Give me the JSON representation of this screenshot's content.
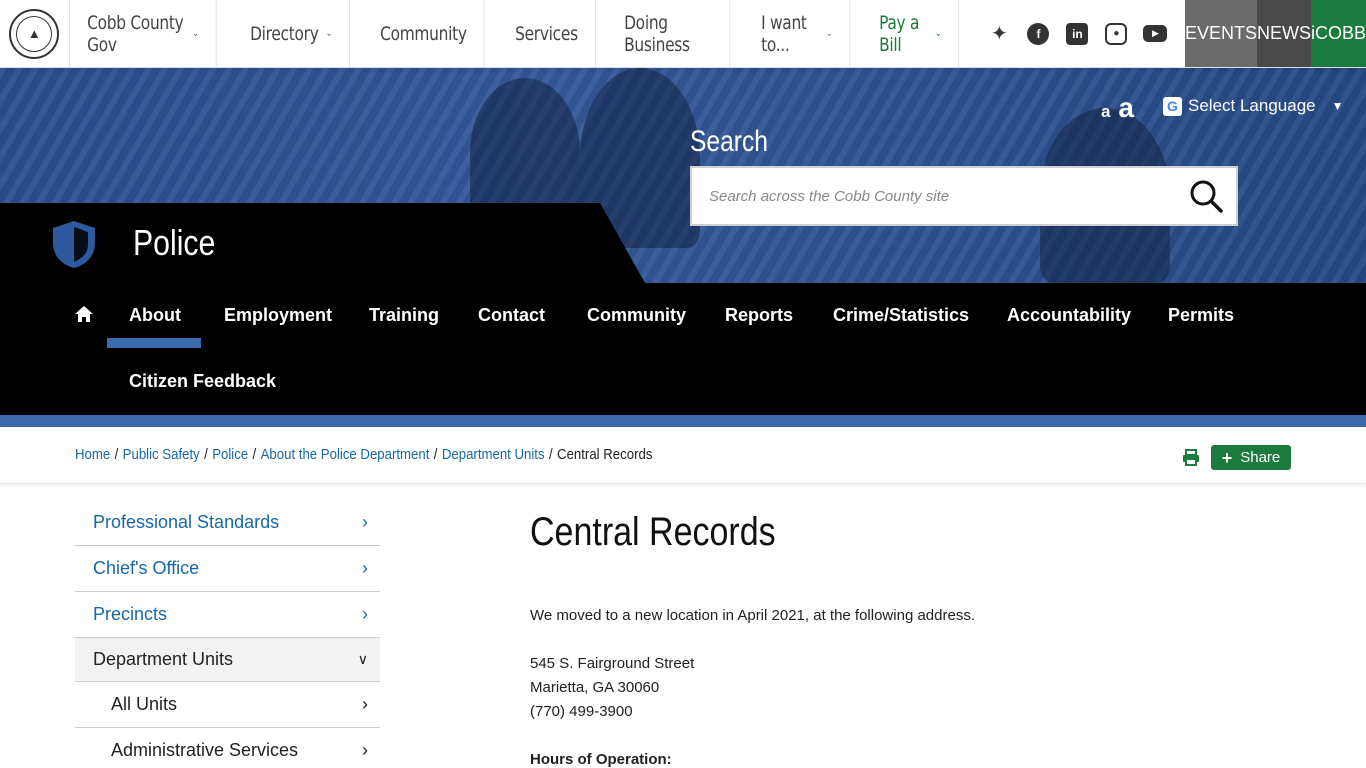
{
  "topnav": {
    "logo_alt": "Cobb County Georgia seal",
    "items": [
      {
        "label": "Cobb County Gov",
        "dropdown": true
      },
      {
        "label": "Directory",
        "dropdown": true
      },
      {
        "label": "Community",
        "dropdown": false
      },
      {
        "label": "Services",
        "dropdown": false
      },
      {
        "label": "Doing Business",
        "dropdown": false
      },
      {
        "label": "I want to...",
        "dropdown": true
      },
      {
        "label": "Pay a Bill",
        "dropdown": true
      }
    ],
    "social": [
      "twitter-icon",
      "facebook-icon",
      "linkedin-icon",
      "instagram-icon",
      "youtube-icon"
    ],
    "tiles": {
      "events": "EVENTS",
      "news": "NEWS",
      "icobb": "iCOBB"
    }
  },
  "colors": {
    "accent_blue": "#3b6aad",
    "link_blue": "#1668a6",
    "brand_green": "#1b7a3e"
  },
  "hero": {
    "text_small": "a",
    "text_large": "a",
    "language": "Select Language",
    "search_label": "Search",
    "search_placeholder": "Search across the Cobb County site"
  },
  "department": {
    "title": "Police"
  },
  "subnav": {
    "items": [
      "About",
      "Employment",
      "Training",
      "Contact",
      "Community",
      "Reports",
      "Crime/Statistics",
      "Accountability",
      "Permits"
    ],
    "row2": [
      "Citizen Feedback"
    ],
    "active": "About"
  },
  "breadcrumb": {
    "links": [
      "Home",
      "Public Safety",
      "Police",
      "About the Police Department",
      "Department Units"
    ],
    "current": "Central Records",
    "separator": "/"
  },
  "actions": {
    "share": "Share"
  },
  "sidebar": {
    "items": [
      {
        "label": "Professional Standards",
        "state": "closed"
      },
      {
        "label": "Chief's Office",
        "state": "closed"
      },
      {
        "label": "Precincts",
        "state": "closed"
      },
      {
        "label": "Department Units",
        "state": "open"
      },
      {
        "label": "All Units",
        "state": "sub"
      },
      {
        "label": "Administrative Services",
        "state": "sub"
      }
    ]
  },
  "main": {
    "title": "Central Records",
    "intro": "We moved to a new location in April 2021, at the following address.",
    "address": [
      "545 S. Fairground Street",
      "Marietta, GA 30060",
      "(770) 499-3900"
    ],
    "hours_heading": "Hours of Operation:"
  }
}
